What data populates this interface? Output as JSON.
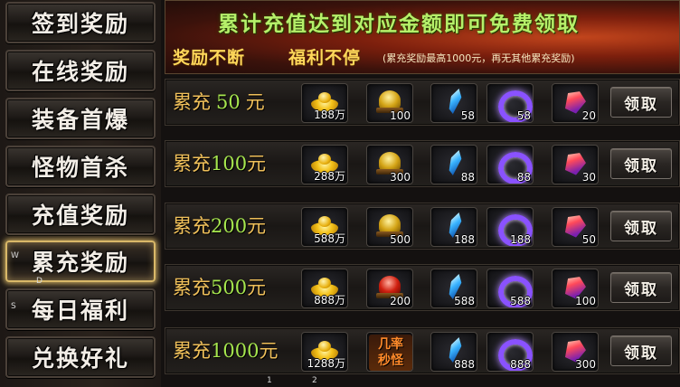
{
  "menu": [
    {
      "label": "签到奖励"
    },
    {
      "label": "在线奖励"
    },
    {
      "label": "装备首爆"
    },
    {
      "label": "怪物首杀"
    },
    {
      "label": "充值奖励"
    },
    {
      "label": "累充奖励"
    },
    {
      "label": "每日福利"
    },
    {
      "label": "兑换好礼"
    }
  ],
  "active_menu": "累充奖励",
  "overlay_marks": {
    "w": "W",
    "d": "D",
    "s": "S",
    "n1": "1",
    "n2": "2"
  },
  "banner": {
    "title": "累计充值达到对应金额即可免费领取",
    "sub1": "奖励不断",
    "sub2": "福利不停",
    "note": "(累充奖励最高1000元，再无其他累充奖励)"
  },
  "colors": {
    "label_gold": "#f0c05a",
    "amount_green": "#a6e64e",
    "active_glow": "#e8c46e",
    "banner_title": "#b6f06a"
  },
  "claim_label": "领取",
  "tiers": [
    {
      "prefix": "累充",
      "amount": "50",
      "unit": "元",
      "items": [
        {
          "icon": "gold-ingot-icon",
          "count": "188万"
        },
        {
          "icon": "gold-helmet-icon",
          "count": "100"
        },
        {
          "icon": "blue-crystal-icon",
          "count": "58"
        },
        {
          "icon": "purple-ring-icon",
          "count": "58"
        },
        {
          "icon": "red-gem-icon",
          "count": "20"
        }
      ]
    },
    {
      "prefix": "累充",
      "amount": "100",
      "unit": "元",
      "items": [
        {
          "icon": "gold-ingot-icon",
          "count": "288万"
        },
        {
          "icon": "gold-helmet-icon",
          "count": "300"
        },
        {
          "icon": "blue-crystal-icon",
          "count": "88"
        },
        {
          "icon": "purple-ring-icon",
          "count": "88"
        },
        {
          "icon": "red-gem-icon",
          "count": "30"
        }
      ]
    },
    {
      "prefix": "累充",
      "amount": "200",
      "unit": "元",
      "items": [
        {
          "icon": "gold-ingot-icon",
          "count": "588万"
        },
        {
          "icon": "gold-helmet-icon",
          "count": "500"
        },
        {
          "icon": "blue-crystal-icon",
          "count": "188"
        },
        {
          "icon": "purple-ring-icon",
          "count": "188"
        },
        {
          "icon": "red-gem-icon",
          "count": "50"
        }
      ]
    },
    {
      "prefix": "累充",
      "amount": "500",
      "unit": "元",
      "items": [
        {
          "icon": "gold-ingot-icon",
          "count": "888万"
        },
        {
          "icon": "red-helmet-icon",
          "count": "200"
        },
        {
          "icon": "blue-crystal-icon",
          "count": "588"
        },
        {
          "icon": "purple-ring-icon",
          "count": "588"
        },
        {
          "icon": "red-gem-icon",
          "count": "100"
        }
      ]
    },
    {
      "prefix": "累充",
      "amount": "1000",
      "unit": "元",
      "items": [
        {
          "icon": "gold-ingot-icon",
          "count": "1288万"
        },
        {
          "icon": "rate-token-icon",
          "count": "",
          "text": "几率\n秒怪"
        },
        {
          "icon": "blue-crystal-icon",
          "count": "888"
        },
        {
          "icon": "purple-ring-icon",
          "count": "888"
        },
        {
          "icon": "red-gem-icon",
          "count": "300"
        }
      ]
    }
  ]
}
